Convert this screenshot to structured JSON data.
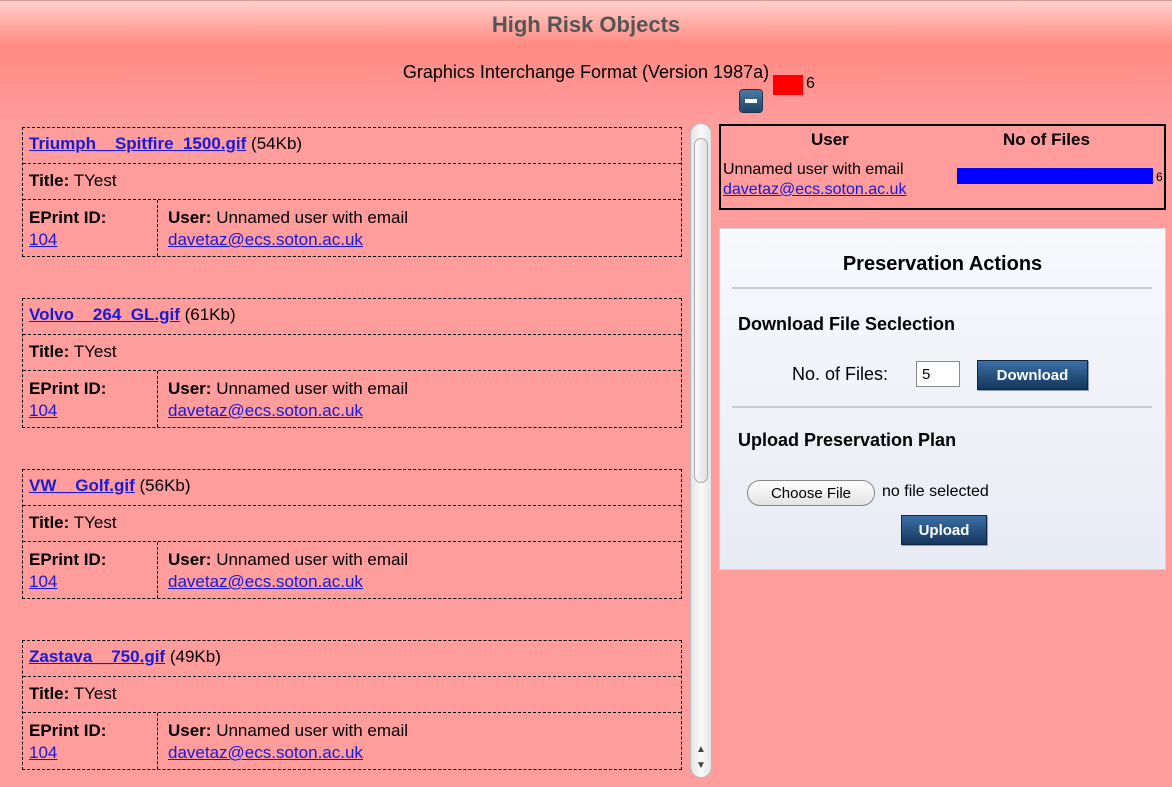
{
  "page": {
    "title": "High Risk Objects",
    "format_name": "Graphics Interchange Format (Version 1987a)",
    "format_count": "6",
    "colors": {
      "background": "#ff9c9c",
      "risk_swatch": "#ff0000",
      "bar": "#0000ff",
      "link": "#1a1ad6"
    }
  },
  "labels": {
    "title_prefix": "Title:",
    "eprint_prefix": "EPrint ID:",
    "user_prefix": "User:"
  },
  "records": [
    {
      "file": "Triumph__Spitfire_1500.gif",
      "size": "(54Kb)",
      "title": "TYest",
      "eprint_id": "104",
      "user_text": "Unnamed user with email",
      "email": "davetaz@ecs.soton.ac.uk"
    },
    {
      "file": "Volvo__264_GL.gif",
      "size": "(61Kb)",
      "title": "TYest",
      "eprint_id": "104",
      "user_text": "Unnamed user with email",
      "email": "davetaz@ecs.soton.ac.uk"
    },
    {
      "file": "VW__Golf.gif",
      "size": "(56Kb)",
      "title": "TYest",
      "eprint_id": "104",
      "user_text": "Unnamed user with email",
      "email": "davetaz@ecs.soton.ac.uk"
    },
    {
      "file": "Zastava__750.gif",
      "size": "(49Kb)",
      "title": "TYest",
      "eprint_id": "104",
      "user_text": "Unnamed user with email",
      "email": "davetaz@ecs.soton.ac.uk"
    }
  ],
  "stats": {
    "header_user": "User",
    "header_files": "No of Files",
    "user_text": "Unnamed user with email",
    "email": "davetaz@ecs.soton.ac.uk",
    "count": "6"
  },
  "actions": {
    "title": "Preservation Actions",
    "download_heading": "Download File Seclection",
    "files_label": "No. of Files:",
    "files_value": "5",
    "download_button": "Download",
    "upload_heading": "Upload Preservation Plan",
    "choose_button": "Choose File",
    "no_file": "no file selected",
    "upload_button": "Upload"
  },
  "icons": {
    "collapse": "minus-square-icon"
  }
}
